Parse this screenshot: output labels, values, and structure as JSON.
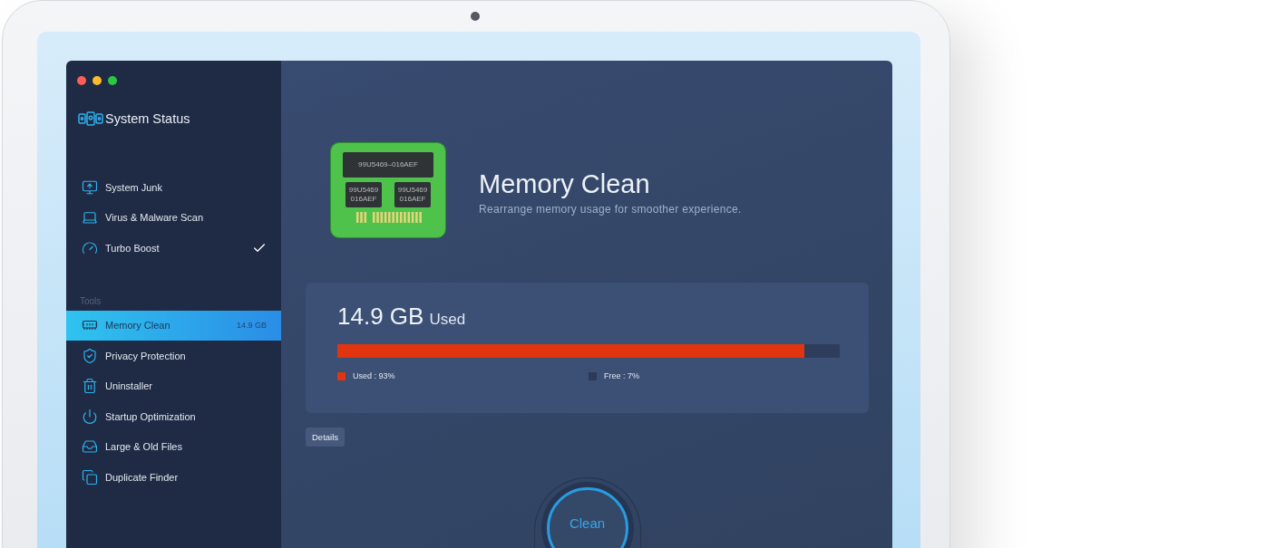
{
  "sidebar": {
    "header": "System Status",
    "items": [
      {
        "label": "System Junk",
        "checked": false
      },
      {
        "label": "Virus & Malware Scan",
        "checked": false
      },
      {
        "label": "Turbo Boost",
        "checked": true
      }
    ],
    "section_label": "Tools",
    "tools": [
      {
        "label": "Memory Clean",
        "badge": "14.9 GB",
        "selected": true
      },
      {
        "label": "Privacy Protection",
        "selected": false
      },
      {
        "label": "Uninstaller",
        "selected": false
      },
      {
        "label": "Startup Optimization",
        "selected": false
      },
      {
        "label": "Large & Old Files",
        "selected": false
      },
      {
        "label": "Duplicate Finder",
        "selected": false
      }
    ]
  },
  "main": {
    "title": "Memory Clean",
    "subtitle": "Rearrange memory usage for smoother experience.",
    "chip_labels": [
      "99U5469–016AEF",
      "99U5469 016AEF",
      "99U5469 016AEF"
    ],
    "usage": {
      "amount": "14.9 GB",
      "unit": "Used",
      "level": 0.93,
      "legend": [
        {
          "label": "Used : 93%",
          "color": "#e0350f"
        },
        {
          "label": "Free : 7%",
          "color": "#2c3a58"
        }
      ]
    },
    "details_button": "Details",
    "clean_button": "Clean"
  }
}
